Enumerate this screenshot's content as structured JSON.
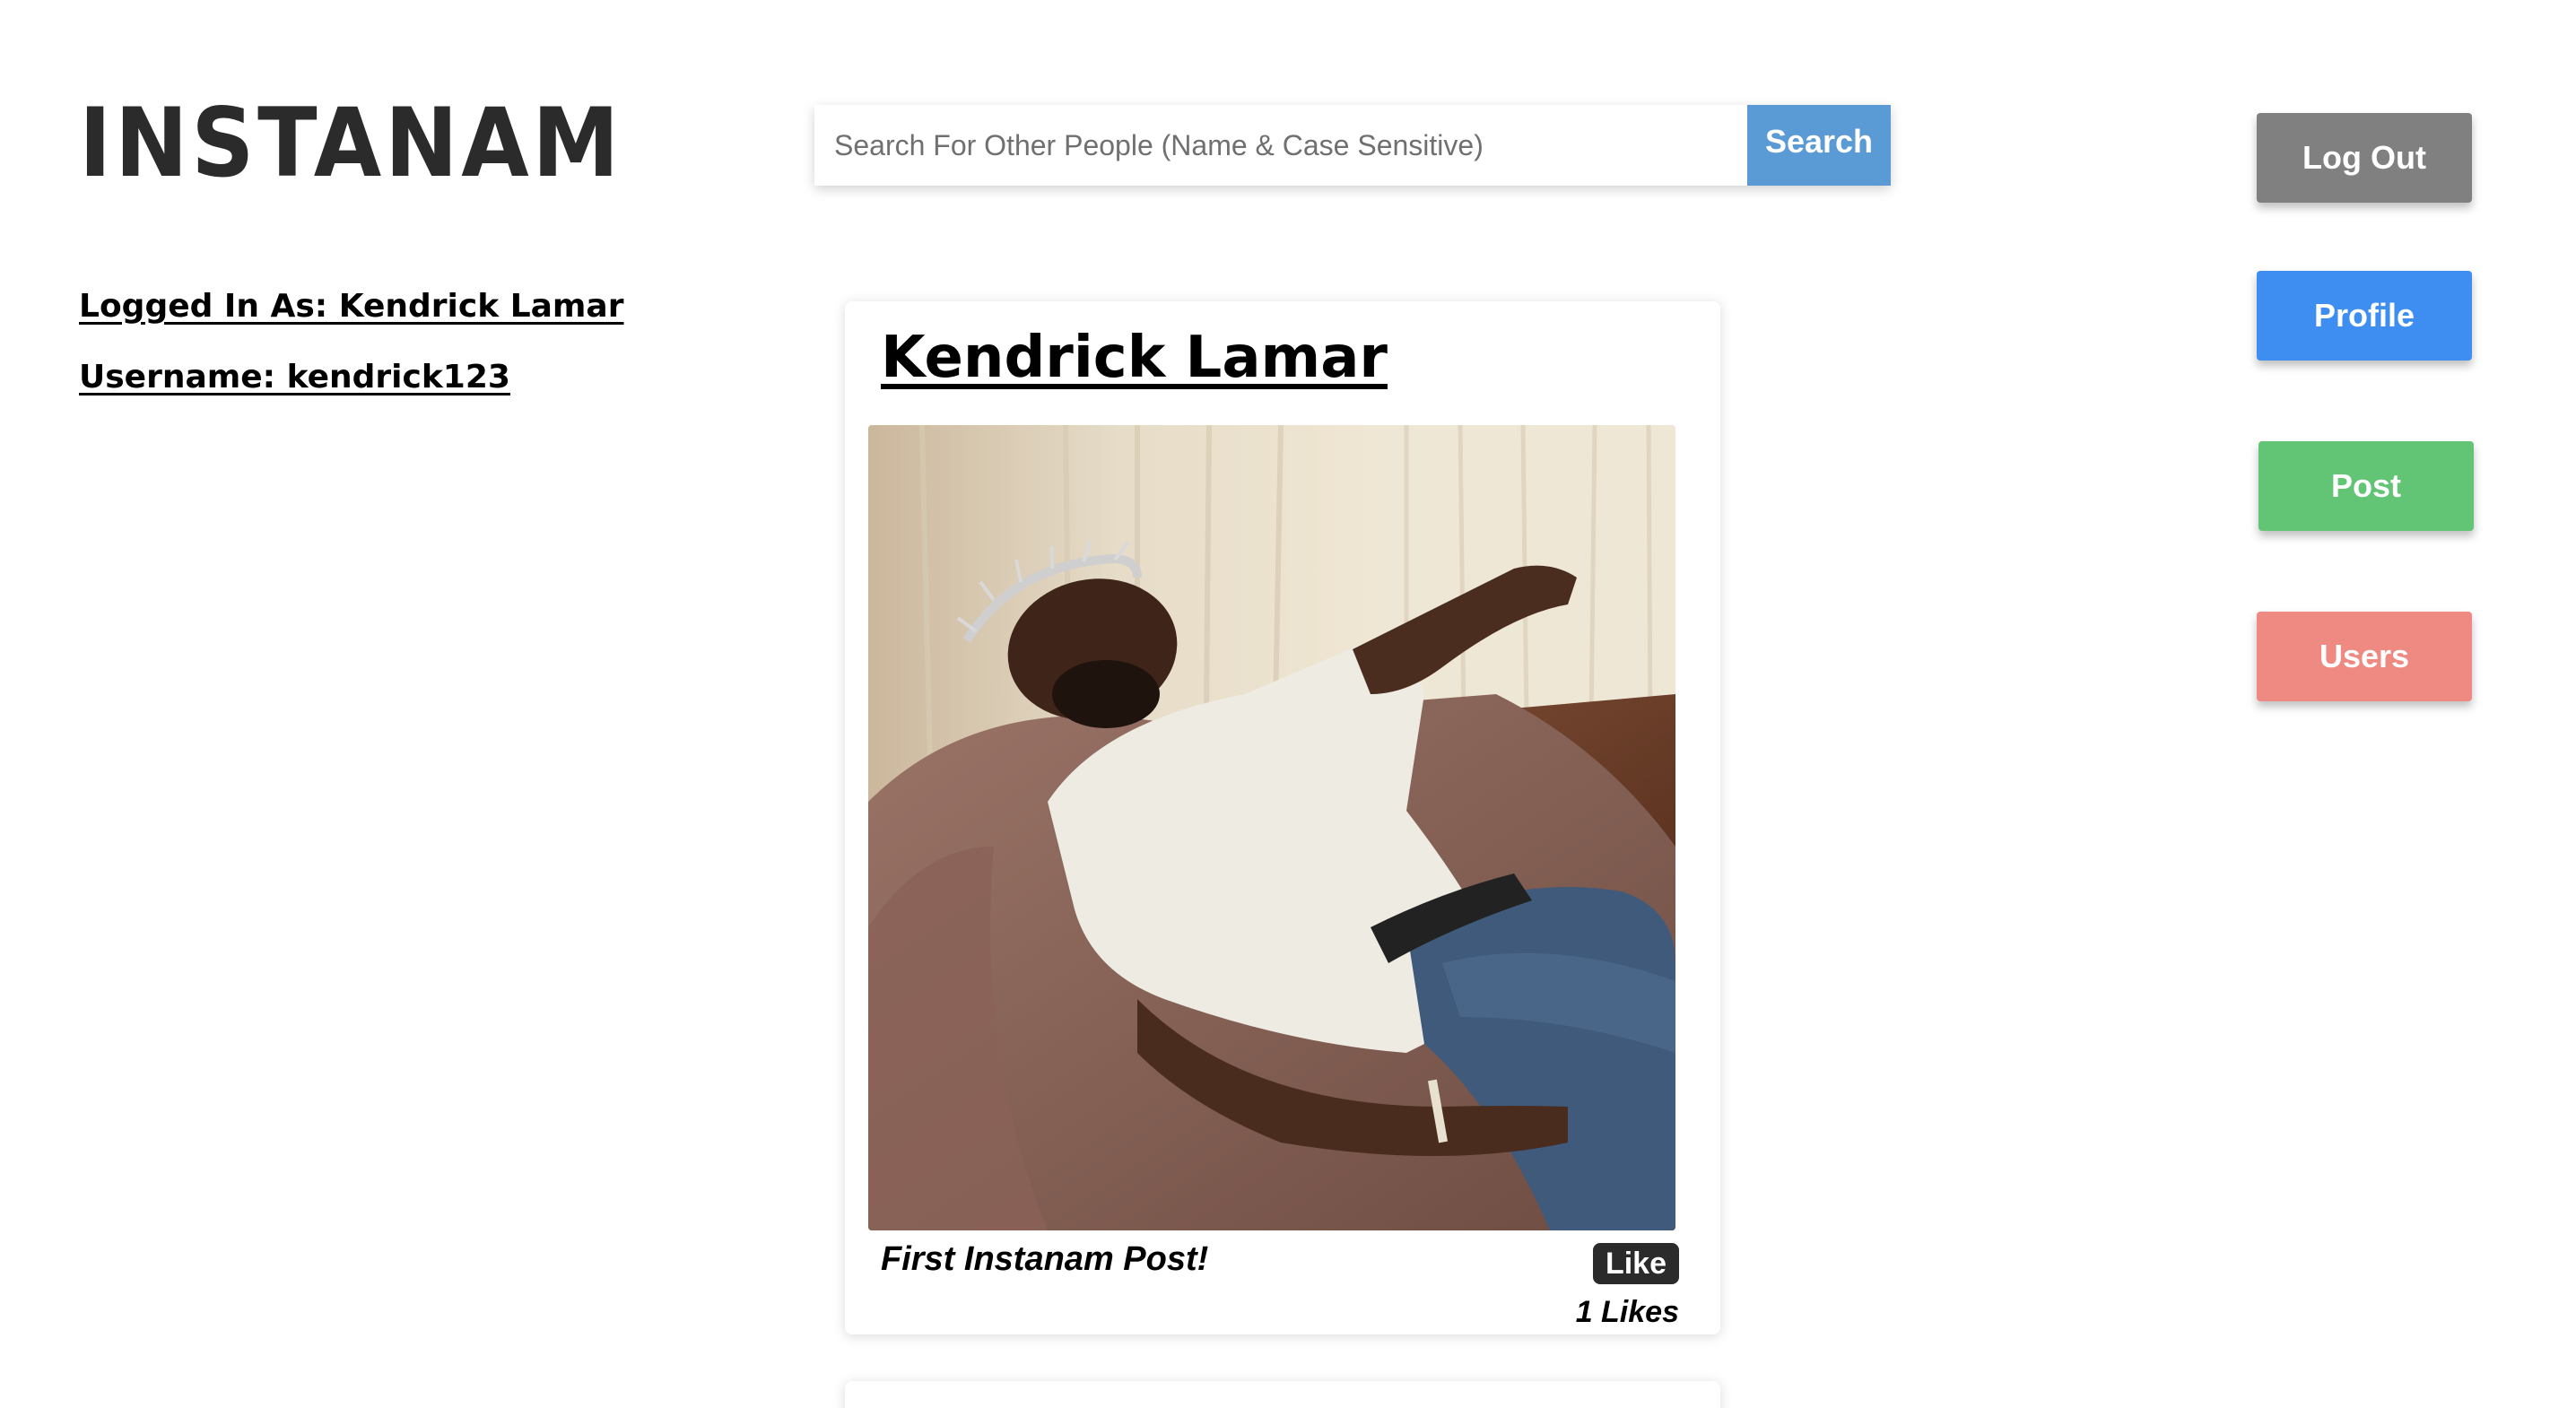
{
  "header": {
    "logo": "INSTANAM"
  },
  "user": {
    "logged_in_as": "Logged In As: Kendrick Lamar",
    "username": "Username: kendrick123"
  },
  "search": {
    "placeholder": "Search For Other People (Name & Case Sensitive)",
    "value": "",
    "button_label": "Search"
  },
  "nav": {
    "logout_label": "Log Out",
    "profile_label": "Profile",
    "post_label": "Post",
    "users_label": "Users"
  },
  "colors": {
    "search_button": "#5b9bd5",
    "logout": "#808080",
    "profile": "#3d8ef0",
    "post": "#62c475",
    "users": "#ef8a82",
    "like_button": "#2b2b2b"
  },
  "feed": {
    "posts": [
      {
        "author": "Kendrick Lamar",
        "image": "photo",
        "caption": "First Instanam Post!",
        "like_label": "Like",
        "likes_text": "1 Likes"
      }
    ]
  }
}
